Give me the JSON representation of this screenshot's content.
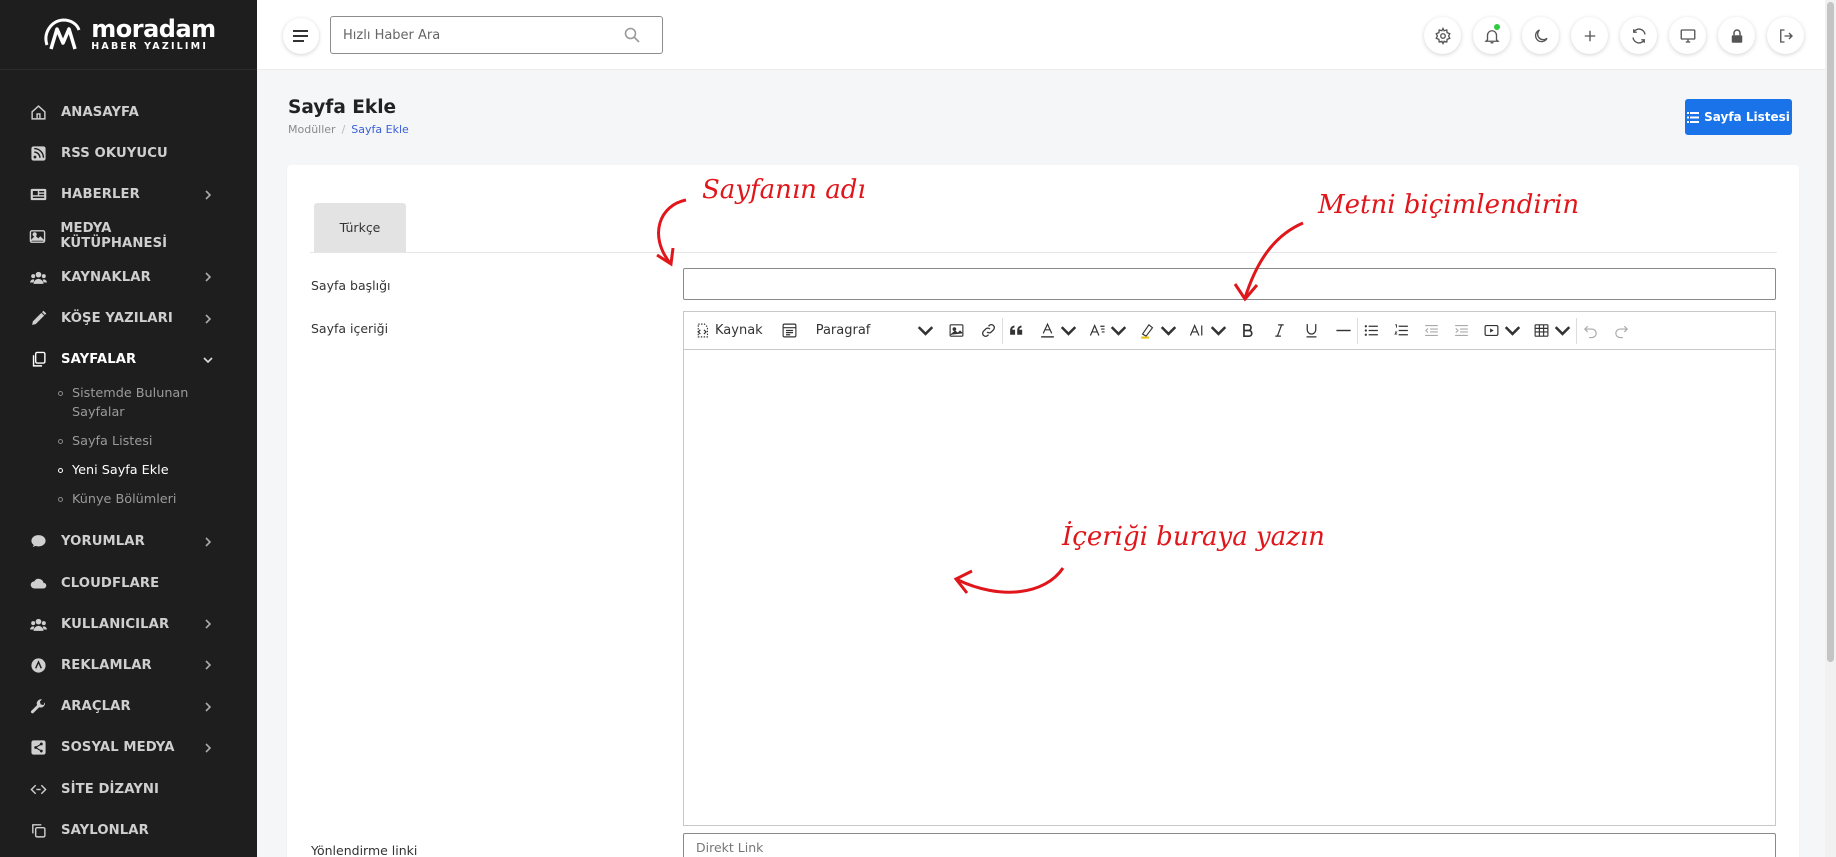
{
  "app": {
    "logo_name": "moradam",
    "logo_sub": "HABER YAZILIMI"
  },
  "sidebar": {
    "items": [
      {
        "label": "ANASAYFA",
        "icon": "home-icon",
        "arrow": false
      },
      {
        "label": "RSS OKUYUCU",
        "icon": "rss-icon",
        "arrow": false
      },
      {
        "label": "HABERLER",
        "icon": "newspaper-icon",
        "arrow": true
      },
      {
        "label": "MEDYA KÜTÜPHANESİ",
        "icon": "image-icon",
        "arrow": false
      },
      {
        "label": "KAYNAKLAR",
        "icon": "users-icon",
        "arrow": true
      },
      {
        "label": "KÖŞE YAZILARI",
        "icon": "pen-icon",
        "arrow": true
      },
      {
        "label": "SAYFALAR",
        "icon": "pages-icon",
        "arrow": true,
        "expanded": true
      },
      {
        "label": "YORUMLAR",
        "icon": "comment-icon",
        "arrow": true
      },
      {
        "label": "CLOUDFLARE",
        "icon": "cloud-icon",
        "arrow": false
      },
      {
        "label": "KULLANICILAR",
        "icon": "users-icon",
        "arrow": true
      },
      {
        "label": "REKLAMLAR",
        "icon": "ad-icon",
        "arrow": true
      },
      {
        "label": "ARAÇLAR",
        "icon": "wrench-icon",
        "arrow": true
      },
      {
        "label": "SOSYAL MEDYA",
        "icon": "share-icon",
        "arrow": true
      },
      {
        "label": "SİTE DİZAYNI",
        "icon": "code-icon",
        "arrow": false
      },
      {
        "label": "SAYLONLAR",
        "icon": "copy-icon",
        "arrow": false
      }
    ],
    "sub_items": [
      {
        "label": "Sistemde Bulunan Sayfalar",
        "active": false
      },
      {
        "label": "Sayfa Listesi",
        "active": false
      },
      {
        "label": "Yeni Sayfa Ekle",
        "active": true
      },
      {
        "label": "Künye Bölümleri",
        "active": false
      }
    ]
  },
  "topbar": {
    "search_placeholder": "Hızlı Haber Ara",
    "icons": [
      "settings-icon",
      "bell-icon",
      "moon-icon",
      "plus-icon",
      "refresh-icon",
      "monitor-icon",
      "lock-icon",
      "logout-icon"
    ]
  },
  "page": {
    "title": "Sayfa Ekle",
    "breadcrumb": [
      "Modüller",
      "Sayfa Ekle"
    ],
    "list_button": "Sayfa Listesi"
  },
  "form": {
    "tab": "Türkçe",
    "title_label": "Sayfa başlığı",
    "content_label": "Sayfa içeriği",
    "redirect_label": "Yönlendirme linki",
    "redirect_placeholder": "Direkt Link",
    "toolbar": {
      "source_label": "Kaynak",
      "paragraph_label": "Paragraf"
    }
  },
  "annotations": {
    "title_note": "Sayfanın adı",
    "format_note": "Metni biçimlendirin",
    "content_note": "İçeriği buraya yazın"
  },
  "colors": {
    "sidebar_bg": "#1e1e1e",
    "accent": "#1a73e8",
    "annotation": "#e0161b"
  }
}
